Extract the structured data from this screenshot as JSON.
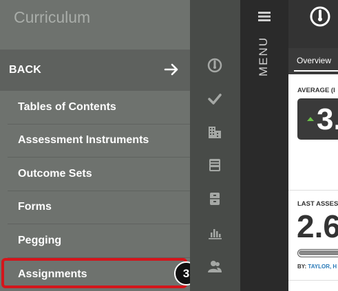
{
  "nav": {
    "title": "Curriculum",
    "back_label": "BACK",
    "items": [
      {
        "label": "Tables of Contents"
      },
      {
        "label": "Assessment Instruments"
      },
      {
        "label": "Outcome Sets"
      },
      {
        "label": "Forms"
      },
      {
        "label": "Pegging"
      },
      {
        "label": "Assignments"
      }
    ]
  },
  "step_badge": "3",
  "rail_icons": [
    "gauge-icon",
    "check-icon",
    "building-icon",
    "inbox-icon",
    "cabinet-icon",
    "bar-chart-icon",
    "users-icon"
  ],
  "menubar": {
    "label": "MENU"
  },
  "main": {
    "tab_label": "Overview",
    "average_label": "AVERAGE (I",
    "average_value": "3.",
    "last_label": "LAST ASSES",
    "last_value": "2.6",
    "progress": 0.9,
    "by_prefix": "BY: ",
    "by_name": "TAYLOR, H"
  },
  "colors": {
    "highlight": "#d4151b",
    "nav_bg": "#6e726e",
    "accent_green": "#6cc04a",
    "link_blue": "#2a7ab8"
  }
}
